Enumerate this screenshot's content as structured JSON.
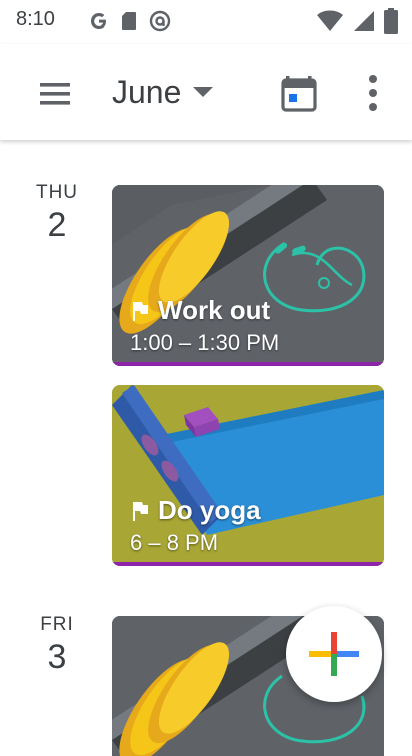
{
  "status_bar": {
    "time": "8:10",
    "icons_left": [
      "google-icon",
      "sd-card-icon",
      "circle-a-icon"
    ],
    "icons_right": [
      "wifi-icon",
      "signal-icon",
      "battery-icon"
    ]
  },
  "app_bar": {
    "month": "June",
    "icons": [
      "menu-icon",
      "dropdown-arrow-icon",
      "today-calendar-icon",
      "more-vert-icon"
    ]
  },
  "days": [
    {
      "dow": "THU",
      "date": "2"
    },
    {
      "dow": "FRI",
      "date": "3"
    }
  ],
  "events": [
    {
      "title": "Work out",
      "time": "1:00 – 1:30 PM",
      "image": "dumbbell-illustration"
    },
    {
      "title": "Do yoga",
      "time": "6 – 8 PM",
      "image": "yoga-mat-illustration"
    },
    {
      "title": "",
      "time": "",
      "image": "dumbbell-illustration"
    }
  ],
  "colors": {
    "event_bar": "#8e24aa",
    "workout_bg": "#5f6368",
    "yoga_bg": "#a8a635",
    "yoga_mat": "#2a8fd6",
    "dumbbell": "#e8b81a"
  },
  "fab": {
    "icon": "add-plus-icon"
  }
}
